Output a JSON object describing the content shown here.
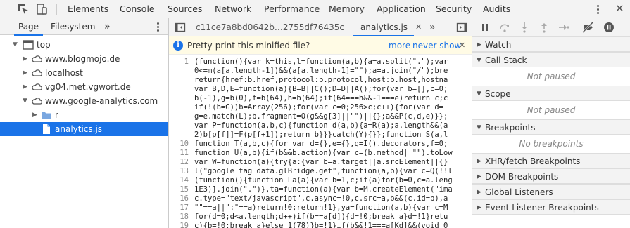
{
  "toolbar": {
    "tabs": [
      "Elements",
      "Console",
      "Sources",
      "Network",
      "Performance",
      "Memory",
      "Application",
      "Security",
      "Audits"
    ],
    "active_tab": "Sources",
    "icons": [
      "inspect-icon",
      "device-toolbar-icon",
      "kebab-menu-icon",
      "close-icon"
    ]
  },
  "navigator": {
    "tabs": [
      "Page",
      "Filesystem"
    ],
    "more": "»",
    "tree": [
      {
        "label": "top",
        "depth": 0,
        "expanded": true,
        "kind": "frame"
      },
      {
        "label": "www.blogmojo.de",
        "depth": 1,
        "expanded": false,
        "kind": "cloud"
      },
      {
        "label": "localhost",
        "depth": 1,
        "expanded": false,
        "kind": "cloud"
      },
      {
        "label": "vg04.met.vgwort.de",
        "depth": 1,
        "expanded": false,
        "kind": "cloud"
      },
      {
        "label": "www.google-analytics.com",
        "depth": 1,
        "expanded": true,
        "kind": "cloud"
      },
      {
        "label": "r",
        "depth": 2,
        "expanded": false,
        "kind": "folder"
      },
      {
        "label": "analytics.js",
        "depth": 3,
        "expanded": false,
        "kind": "file",
        "selected": true
      }
    ]
  },
  "editor": {
    "tabs": [
      "c11ce7a8bd0642b…2755df76435c1b",
      "analytics.js"
    ],
    "active_tab": "analytics.js",
    "more": "»",
    "infobar": {
      "message": "Pretty-print this minified file?",
      "more": "more",
      "never_show": "never show"
    },
    "lines": [
      {
        "n": "1",
        "t": "(function(){var k=this,l=function(a,b){a=a.split(\".\");var"
      },
      {
        "n": "",
        "t": "0<=m(a[a.length-1])&&(a[a.length-1]=\"\");a=a.join(\"/\");bre"
      },
      {
        "n": "",
        "t": "return{href:b.href,protocol:b.protocol,host:b.host,hostna"
      },
      {
        "n": "",
        "t": "var B,D,E=function(a){B=B||C();D=D||A();for(var b=[],c=0;"
      },
      {
        "n": "",
        "t": "b(-1),g=b(0),f=b(64),h=b(64);if(64===h&&-1===e)return c;c"
      },
      {
        "n": "",
        "t": "if(!(b=G))b=Array(256);for(var c=0;256>c;c++){for(var d="
      },
      {
        "n": "",
        "t": "g=e.match(L);b.fragment=O(g&&g[3]||\"\")||{};a&&P(c,d,e)}};"
      },
      {
        "n": "",
        "t": "var P=function(a,b,c){function d(a,b){a=R(a);a.length&&(a"
      },
      {
        "n": "",
        "t": "2)b[p[f]]=F(p[f+1]);return b}}}catch(Y){}};function S(a,l"
      },
      {
        "n": "10",
        "t": "function T(a,b,c){for var d={},e={},g=I().decorators,f=0;"
      },
      {
        "n": "11",
        "t": "function U(a,b){if(b&&b.action){var c=(b.method||\"\").toLow"
      },
      {
        "n": "12",
        "t": "var W=function(a){try{a:{var b=a.target||a.srcElement||{}"
      },
      {
        "n": "13",
        "t": "l(\"google_tag_data.glBridge.get\",function(a,b){var c=Q(!!l"
      },
      {
        "n": "14",
        "t": "(function(){function La(a){var b=1,c;if(a)for(b=0,c=a.leng"
      },
      {
        "n": "15",
        "t": "1E3)].join(\".\")},ta=function(a){var b=M.createElement(\"ima"
      },
      {
        "n": "16",
        "t": "c.type=\"text/javascript\",c.async=!0,c.src=a,b&&(c.id=b),a"
      },
      {
        "n": "17",
        "t": "\"\"==a||\":\"==a)return!0;return!1},ya=function(a,b){var c=M"
      },
      {
        "n": "18",
        "t": "for(d=0;d<a.length;d++)if(b==a[d]){d=!0;break a}d=!1}retu"
      },
      {
        "n": "19",
        "t": "c){b=!0;break a}else 1(78)}b=!1}if(b&&!1===a[Kd]&&(void 0"
      }
    ]
  },
  "debugger": {
    "icons": [
      "pause-icon",
      "step-over-icon",
      "step-into-icon",
      "step-out-icon",
      "step-icon",
      "deactivate-breakpoints-icon",
      "pause-on-exceptions-icon"
    ],
    "panes": [
      {
        "title": "Watch",
        "expanded": false,
        "placeholder": ""
      },
      {
        "title": "Call Stack",
        "expanded": true,
        "placeholder": "Not paused"
      },
      {
        "title": "Scope",
        "expanded": true,
        "placeholder": "Not paused"
      },
      {
        "title": "Breakpoints",
        "expanded": true,
        "placeholder": "No breakpoints"
      },
      {
        "title": "XHR/fetch Breakpoints",
        "expanded": false,
        "placeholder": ""
      },
      {
        "title": "DOM Breakpoints",
        "expanded": false,
        "placeholder": ""
      },
      {
        "title": "Global Listeners",
        "expanded": false,
        "placeholder": ""
      },
      {
        "title": "Event Listener Breakpoints",
        "expanded": false,
        "placeholder": ""
      }
    ]
  },
  "colors": {
    "accent": "#1a73e8",
    "toolbar_bg": "#f3f3f3",
    "infobar_bg": "#fffbe5",
    "selected_bg": "#1a73e8"
  }
}
